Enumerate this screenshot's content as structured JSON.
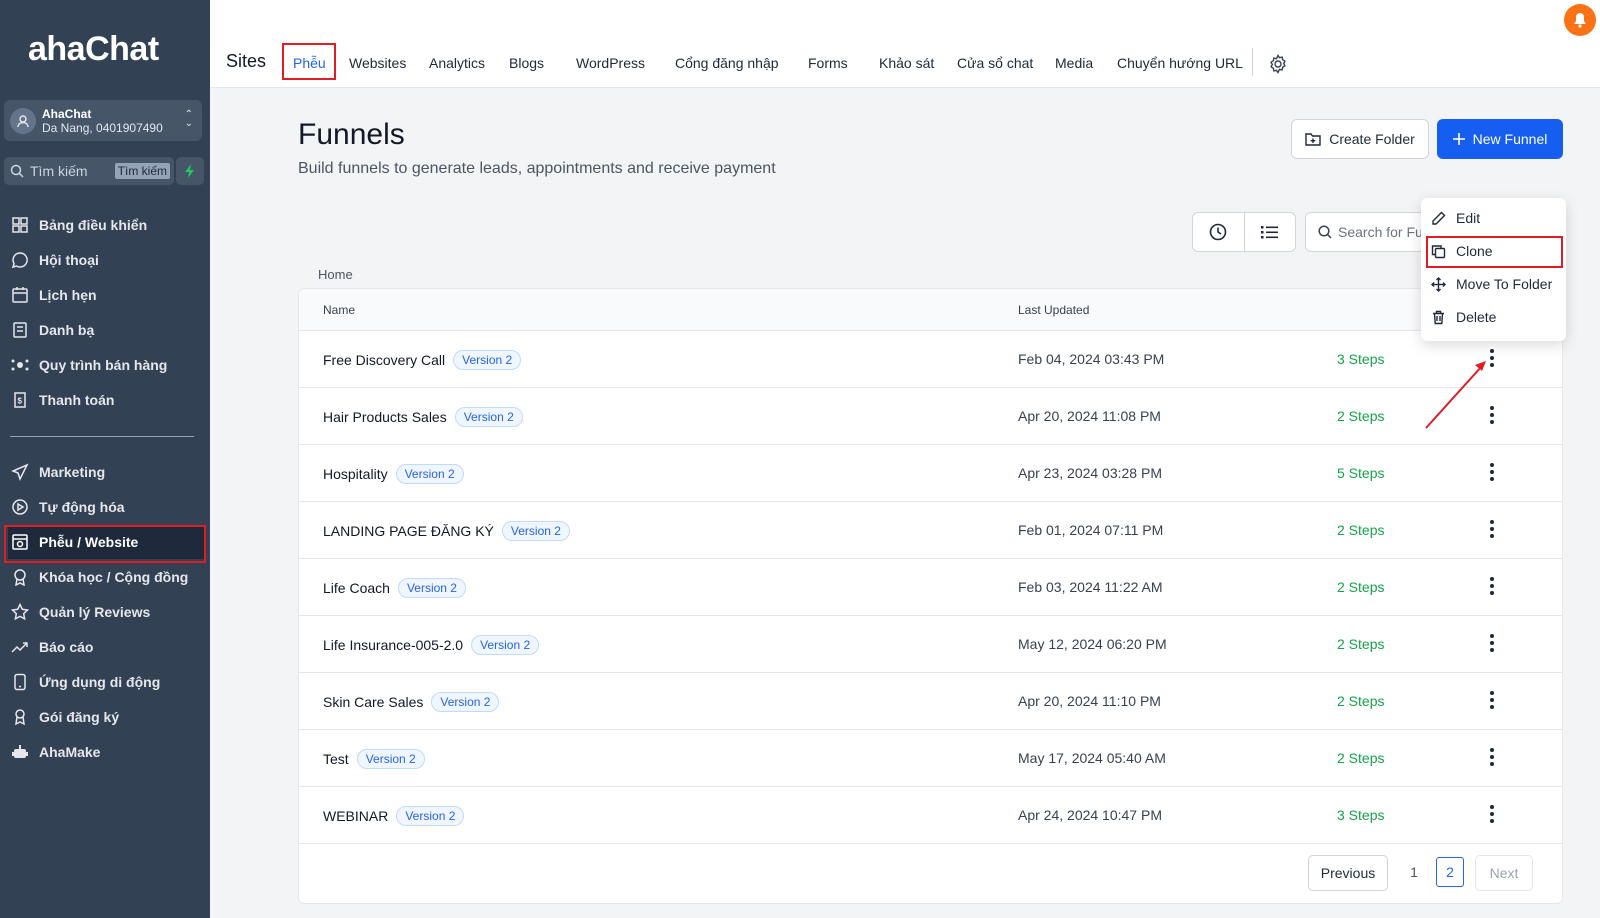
{
  "brand": {
    "logo": "ahaChat"
  },
  "account": {
    "name": "AhaChat",
    "subtitle": "Da Nang, 0401907490"
  },
  "sidebar_search": {
    "placeholder": "Tìm kiếm",
    "shortcut": "Tìm kiếm"
  },
  "sidebar": {
    "items": [
      {
        "label": "Bảng điều khiển",
        "icon": "dashboard-icon"
      },
      {
        "label": "Hội thoại",
        "icon": "chat-icon"
      },
      {
        "label": "Lịch hẹn",
        "icon": "calendar-icon"
      },
      {
        "label": "Danh bạ",
        "icon": "contacts-icon"
      },
      {
        "label": "Quy trình bán hàng",
        "icon": "pipeline-icon"
      },
      {
        "label": "Thanh toán",
        "icon": "payment-icon"
      }
    ],
    "items2": [
      {
        "label": "Marketing",
        "icon": "send-icon"
      },
      {
        "label": "Tự động hóa",
        "icon": "automation-icon"
      },
      {
        "label": "Phễu / Website",
        "icon": "funnel-icon",
        "active": true
      },
      {
        "label": "Khóa học / Cộng đồng",
        "icon": "course-icon"
      },
      {
        "label": "Quản lý Reviews",
        "icon": "star-icon"
      },
      {
        "label": "Báo cáo",
        "icon": "report-icon"
      },
      {
        "label": "Ứng dụng di động",
        "icon": "mobile-icon"
      },
      {
        "label": "Gói đăng ký",
        "icon": "badge-icon"
      },
      {
        "label": "AhaMake",
        "icon": "robot-icon"
      }
    ]
  },
  "topnav": {
    "sites": "Sites",
    "tabs": [
      "Phễu",
      "Websites",
      "Analytics",
      "Blogs",
      "WordPress",
      "Cổng đăng nhập",
      "Forms",
      "Khảo sát",
      "Cửa sổ chat",
      "Media",
      "Chuyển hướng URL"
    ],
    "active_tab": "Phễu"
  },
  "page": {
    "title": "Funnels",
    "subtitle": "Build funnels to generate leads, appointments and receive payment",
    "create_folder": "Create Folder",
    "new_funnel": "New Funnel",
    "search_placeholder": "Search for Funnels",
    "breadcrumb": "Home"
  },
  "table": {
    "headers": {
      "name": "Name",
      "updated": "Last Updated"
    },
    "rows": [
      {
        "name": "Free Discovery Call",
        "version": "Version 2",
        "updated": "Feb 04, 2024 03:43 PM",
        "steps": "3 Steps"
      },
      {
        "name": "Hair Products Sales",
        "version": "Version 2",
        "updated": "Apr 20, 2024 11:08 PM",
        "steps": "2 Steps"
      },
      {
        "name": "Hospitality",
        "version": "Version 2",
        "updated": "Apr 23, 2024 03:28 PM",
        "steps": "5 Steps"
      },
      {
        "name": "LANDING PAGE ĐĂNG KÝ",
        "version": "Version 2",
        "updated": "Feb 01, 2024 07:11 PM",
        "steps": "2 Steps"
      },
      {
        "name": "Life Coach",
        "version": "Version 2",
        "updated": "Feb 03, 2024 11:22 AM",
        "steps": "2 Steps"
      },
      {
        "name": "Life Insurance-005-2.0",
        "version": "Version 2",
        "updated": "May 12, 2024 06:20 PM",
        "steps": "2 Steps"
      },
      {
        "name": "Skin Care Sales",
        "version": "Version 2",
        "updated": "Apr 20, 2024 11:10 PM",
        "steps": "2 Steps"
      },
      {
        "name": "Test",
        "version": "Version 2",
        "updated": "May 17, 2024 05:40 AM",
        "steps": "2 Steps"
      },
      {
        "name": "WEBINAR",
        "version": "Version 2",
        "updated": "Apr 24, 2024 10:47 PM",
        "steps": "3 Steps"
      }
    ]
  },
  "pagination": {
    "previous": "Previous",
    "pages": [
      "1",
      "2"
    ],
    "current": "2",
    "next": "Next"
  },
  "context_menu": {
    "items": [
      "Edit",
      "Clone",
      "Move To Folder",
      "Delete"
    ],
    "highlighted": "Clone"
  },
  "colors": {
    "primary": "#155eef",
    "sidebar": "#334155",
    "steps": "#16a34a",
    "highlight": "#e11d24"
  }
}
